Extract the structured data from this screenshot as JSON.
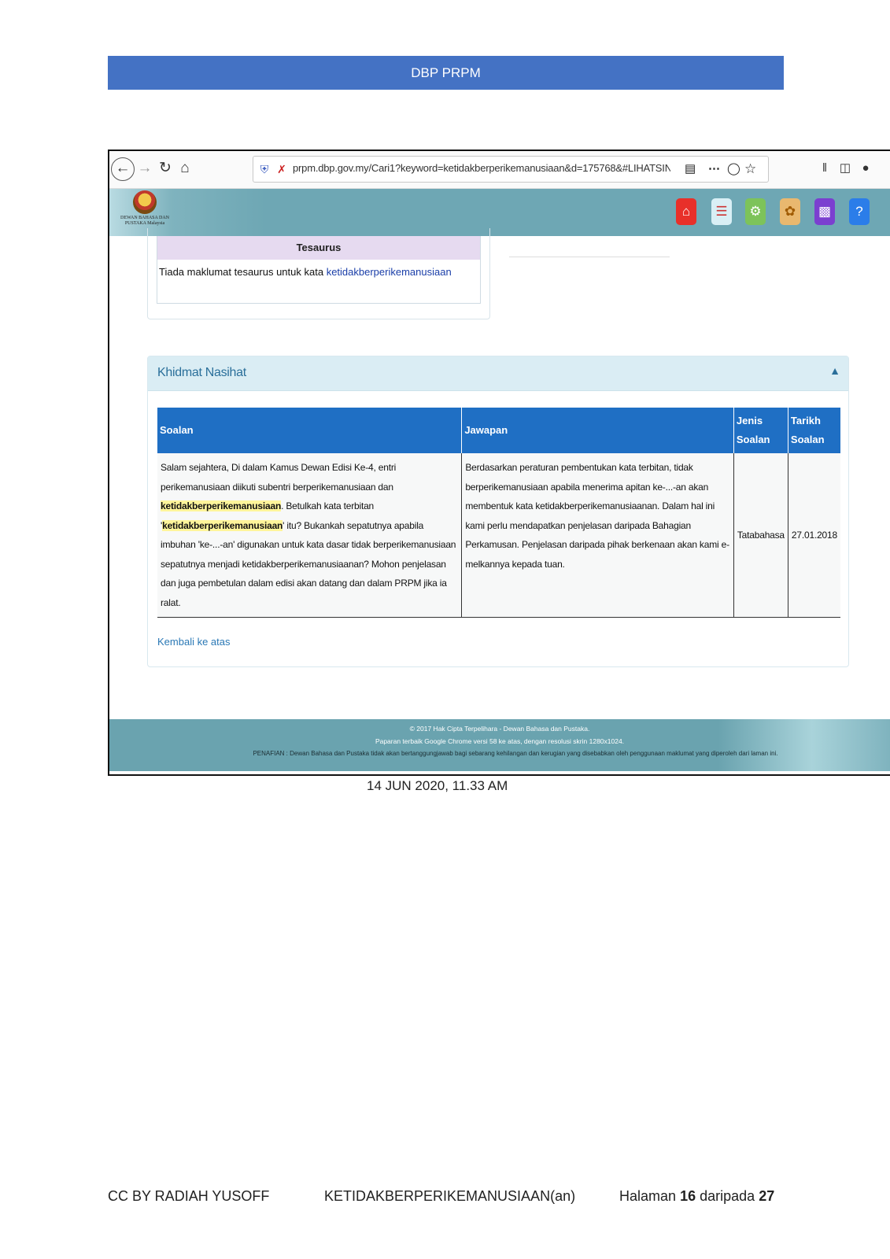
{
  "header": {
    "title": "DBP PRPM"
  },
  "browser": {
    "url": "prpm.dbp.gov.my/Cari1?keyword=ketidakberperikemanusiaan&d=175768&#LIHATSINI",
    "icons": [
      "back-icon",
      "forward-icon",
      "reload-icon",
      "home-icon",
      "shield-icon",
      "insecure-lock-icon",
      "reader-view-icon",
      "more-icon",
      "pocket-icon",
      "star-icon",
      "library-icon",
      "sidebar-icon",
      "account-icon"
    ]
  },
  "site": {
    "logo_text": "DEWAN BAHASA DAN PUSTAKA Malaysia",
    "nav_icons": [
      "home-icon",
      "kamus-icon",
      "makmal-icon",
      "dbp-emblem-icon",
      "info-icon",
      "help-icon"
    ]
  },
  "tesaurus": {
    "title": "Tesaurus",
    "message": "Tiada maklumat tesaurus untuk kata",
    "keyword": "ketidakberperikemanusiaan"
  },
  "khidmat": {
    "title": "Khidmat Nasihat",
    "toggle_icon": "chevron-up-icon",
    "headers": {
      "soalan": "Soalan",
      "jawapan": "Jawapan",
      "jenis": "Jenis Soalan",
      "tarikh": "Tarikh Soalan"
    },
    "row": {
      "q1": "Salam sejahtera, Di dalam Kamus Dewan Edisi Ke-4, entri perikemanusiaan diikuti subentri berperikemanusiaan dan ",
      "q_hl1": "ketidakberperikemanusiaan",
      "q2": ". Betulkah kata terbitan '",
      "q_hl2": "ketidakberperikemanusiaan",
      "q3": "' itu? Bukankah sepatutnya apabila imbuhan 'ke-...-an' digunakan untuk kata dasar tidak berperikemanusiaan sepatutnya menjadi ketidakberperikemanusiaanan? Mohon penjelasan dan juga pembetulan dalam edisi akan datang dan dalam PRPM jika ia ralat.",
      "answer": "Berdasarkan peraturan pembentukan kata terbitan, tidak berperikemanusiaan apabila menerima apitan ke-...-an akan membentuk kata ketidakberperikemanusiaanan. Dalam hal ini kami perlu mendapatkan penjelasan daripada Bahagian Perkamusan. Penjelasan daripada pihak berkenaan akan kami e-melkannya kepada tuan.",
      "jenis": "Tatabahasa",
      "tarikh": "27.01.2018"
    },
    "back_link": "Kembali ke atas"
  },
  "site_footer": {
    "line1": "© 2017 Hak Cipta Terpelihara - Dewan Bahasa dan Pustaka.",
    "line2": "Paparan terbaik Google Chrome versi 58 ke atas, dengan resolusi skrin 1280x1024.",
    "line3": "PENAFIAN : Dewan Bahasa dan Pustaka tidak akan bertanggungjawab bagi sebarang kehilangan dan kerugian yang disebabkan oleh penggunaan maklumat yang diperoleh dari laman ini."
  },
  "timestamp": "14 JUN 2020, 11.33 AM",
  "doc_footer": {
    "left": "CC BY RADIAH YUSOFF",
    "middle": "KETIDAKBERPERIKEMANUSIAAN(an)",
    "page_prefix": "Halaman",
    "page_num": "16",
    "page_sep": "daripada",
    "page_total": "27"
  }
}
